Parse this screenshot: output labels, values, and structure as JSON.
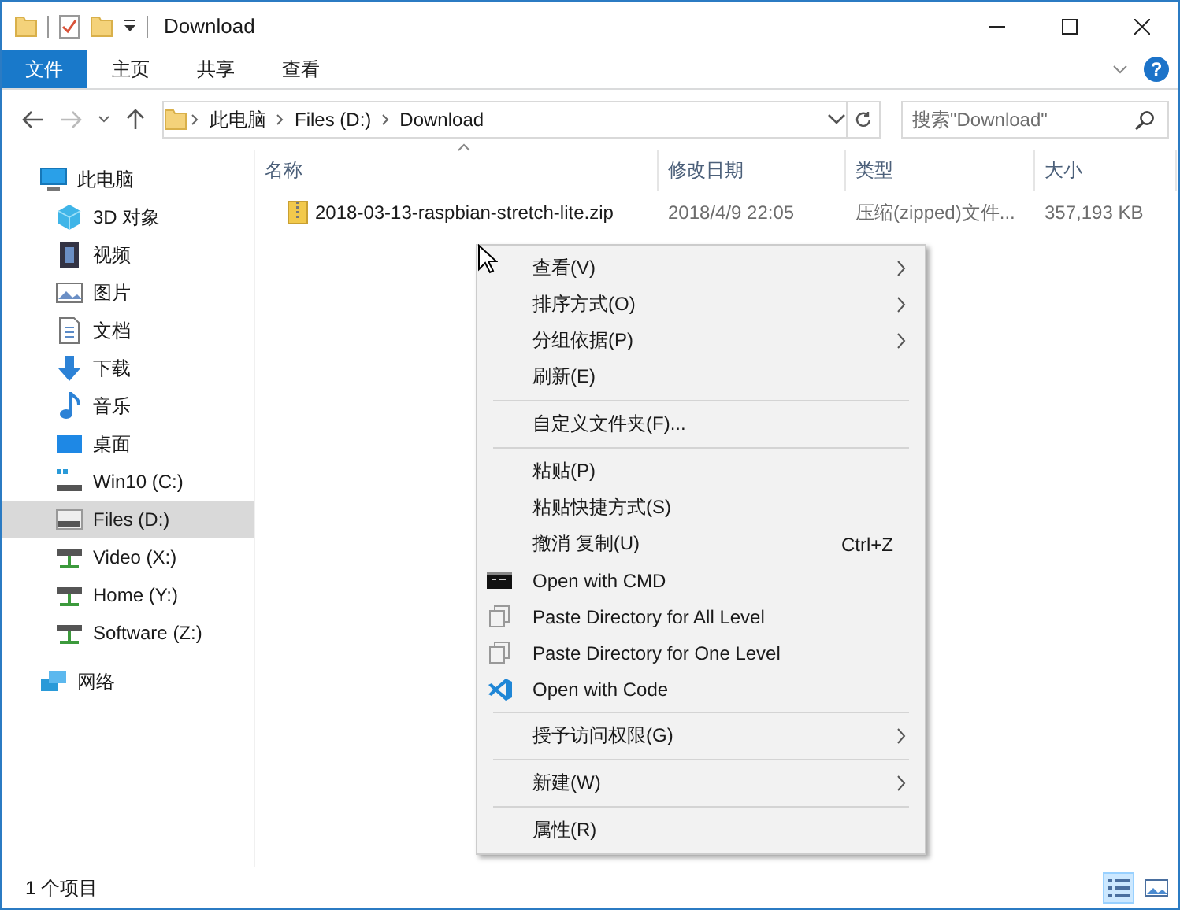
{
  "window": {
    "title": "Download"
  },
  "ribbon": {
    "tabs": [
      {
        "label": "文件",
        "selected": true
      },
      {
        "label": "主页",
        "selected": false
      },
      {
        "label": "共享",
        "selected": false
      },
      {
        "label": "查看",
        "selected": false
      }
    ],
    "help": "?"
  },
  "address": {
    "crumbs": [
      "此电脑",
      "Files (D:)",
      "Download"
    ],
    "search": {
      "placeholder": "搜索\"Download\""
    }
  },
  "sidebar": {
    "items": [
      {
        "label": "此电脑",
        "selected": false,
        "children": [
          {
            "label": "3D 对象",
            "selected": false
          },
          {
            "label": "视频",
            "selected": false
          },
          {
            "label": "图片",
            "selected": false
          },
          {
            "label": "文档",
            "selected": false
          },
          {
            "label": "下载",
            "selected": false
          },
          {
            "label": "音乐",
            "selected": false
          },
          {
            "label": "桌面",
            "selected": false
          },
          {
            "label": "Win10 (C:)",
            "selected": false
          },
          {
            "label": "Files (D:)",
            "selected": true
          },
          {
            "label": "Video (X:)",
            "selected": false
          },
          {
            "label": "Home (Y:)",
            "selected": false
          },
          {
            "label": "Software (Z:)",
            "selected": false
          }
        ]
      },
      {
        "label": "网络",
        "selected": false
      }
    ]
  },
  "table": {
    "columns": [
      "名称",
      "修改日期",
      "类型",
      "大小"
    ],
    "rows": [
      {
        "cells": [
          "2018-03-13-raspbian-stretch-lite.zip",
          "2018/4/9 22:05",
          "压缩(zipped)文件...",
          "357,193 KB"
        ],
        "selected": false
      }
    ]
  },
  "context_menu": {
    "items": [
      {
        "kind": "command",
        "label": "查看(V)",
        "submenu": true
      },
      {
        "kind": "command",
        "label": "排序方式(O)",
        "submenu": true
      },
      {
        "kind": "command",
        "label": "分组依据(P)",
        "submenu": true
      },
      {
        "kind": "command",
        "label": "刷新(E)",
        "submenu": false
      },
      {
        "kind": "separator"
      },
      {
        "kind": "command",
        "label": "自定义文件夹(F)...",
        "submenu": false
      },
      {
        "kind": "separator"
      },
      {
        "kind": "command",
        "label": "粘贴(P)",
        "submenu": false
      },
      {
        "kind": "command",
        "label": "粘贴快捷方式(S)",
        "submenu": false
      },
      {
        "kind": "command",
        "label": "撤消 复制(U)",
        "shortcut": "Ctrl+Z",
        "submenu": false
      },
      {
        "kind": "terminal",
        "label": "Open with CMD",
        "submenu": false
      },
      {
        "kind": "copy",
        "label": "Paste Directory for All Level",
        "submenu": false
      },
      {
        "kind": "copy",
        "label": "Paste Directory for One Level",
        "submenu": false
      },
      {
        "kind": "editor",
        "label": "Open with Code",
        "submenu": false
      },
      {
        "kind": "separator"
      },
      {
        "kind": "command",
        "label": "授予访问权限(G)",
        "submenu": true
      },
      {
        "kind": "separator"
      },
      {
        "kind": "command",
        "label": "新建(W)",
        "submenu": true
      },
      {
        "kind": "separator"
      },
      {
        "kind": "command",
        "label": "属性(R)",
        "submenu": false
      }
    ]
  },
  "status_bar": {
    "text": "1 个项目"
  }
}
